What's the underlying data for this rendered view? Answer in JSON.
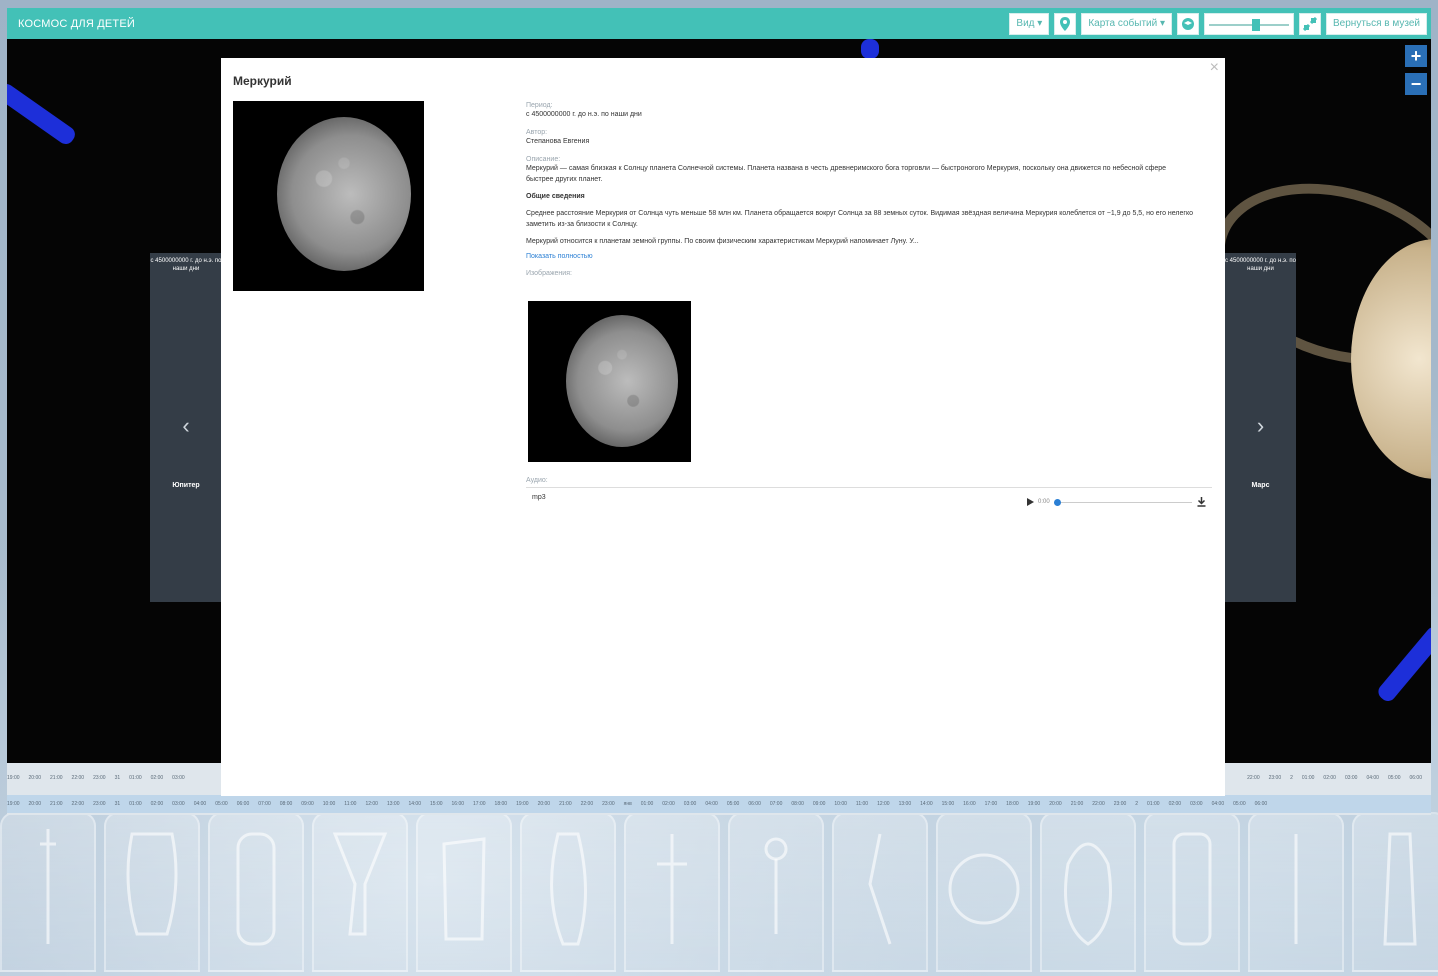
{
  "app": {
    "title": "КОСМОС ДЛЯ ДЕТЕЙ"
  },
  "toolbar": {
    "view_label": "Вид ▾",
    "events_map_label": "Карта событий ▾",
    "back_label": "Вернуться в музей",
    "slider_level": 0.6
  },
  "zoom": {
    "plus": "+",
    "minus": "−"
  },
  "side": {
    "left": {
      "period": "с 4500000000 г. до н.э. по наши дни",
      "name": "Юпитер",
      "arrow": "‹"
    },
    "right": {
      "period": "с 4500000000 г. до н.э. по наши дни",
      "name": "Марс",
      "arrow": "›"
    }
  },
  "modal": {
    "close": "×",
    "title": "Меркурий",
    "period_label": "Период:",
    "period_value": "с 4500000000 г. до н.э. по наши дни",
    "author_label": "Автор:",
    "author_value": "Степанова Евгения",
    "description_label": "Описание:",
    "description_value": "Меркурий — самая близкая к Солнцу планета Солнечной системы. Планета названа в честь древнеримского бога торговли — быстроногого Меркурия, поскольку она движется по небесной сфере быстрее других планет.",
    "general_title": "Общие сведения",
    "general_p1": "Среднее расстояние Меркурия от Солнца чуть меньше 58 млн км. Планета обращается вокруг Солнца за 88 земных суток. Видимая звёздная величина Меркурия колеблется от −1,9 до 5,5, но его нелегко заметить из-за близости к Солнцу.",
    "general_p2": "Меркурий относится к планетам земной группы. По своим физическим характеристикам Меркурий напоминает Луну. У...",
    "show_full": "Показать полностью",
    "images_label": "Изображения:",
    "audio_label": "Аудио:",
    "audio_file": "mp3",
    "audio_time": "0:00",
    "audio_progress": 0
  },
  "timeline": {
    "row1": [
      "19:00",
      "20:00",
      "21:00",
      "22:00",
      "23:00",
      "31",
      "01:00",
      "02:00",
      "03:00"
    ],
    "row2": [
      "19:00",
      "20:00",
      "21:00",
      "22:00",
      "23:00",
      "31",
      "01:00",
      "02:00",
      "03:00",
      "04:00",
      "05:00",
      "06:00",
      "07:00",
      "08:00",
      "09:00",
      "10:00",
      "11:00",
      "12:00",
      "13:00",
      "14:00",
      "15:00",
      "16:00",
      "17:00",
      "18:00",
      "19:00",
      "20:00",
      "21:00",
      "22:00",
      "23:00",
      "янв",
      "01:00",
      "02:00",
      "03:00",
      "04:00",
      "05:00",
      "06:00",
      "07:00",
      "08:00",
      "09:00",
      "10:00",
      "11:00",
      "12:00",
      "13:00",
      "14:00",
      "15:00",
      "16:00",
      "17:00",
      "18:00",
      "19:00",
      "20:00",
      "21:00",
      "22:00",
      "23:00",
      "2",
      "01:00",
      "02:00",
      "03:00",
      "04:00",
      "05:00",
      "06:00"
    ],
    "row1_right": [
      "22:00",
      "23:00",
      "2",
      "01:00",
      "02:00",
      "03:00",
      "04:00",
      "05:00",
      "06:00"
    ]
  },
  "colors": {
    "topbar": "#43c1b7",
    "modal_bg": "#ffffff",
    "link": "#2a7fd4",
    "stage": "#050505"
  },
  "icons": [
    "map-marker-icon",
    "layers-icon",
    "fullscreen-icon",
    "plus-icon",
    "minus-icon",
    "play-icon",
    "download-icon",
    "chevron-left-icon",
    "chevron-right-icon",
    "close-icon"
  ]
}
